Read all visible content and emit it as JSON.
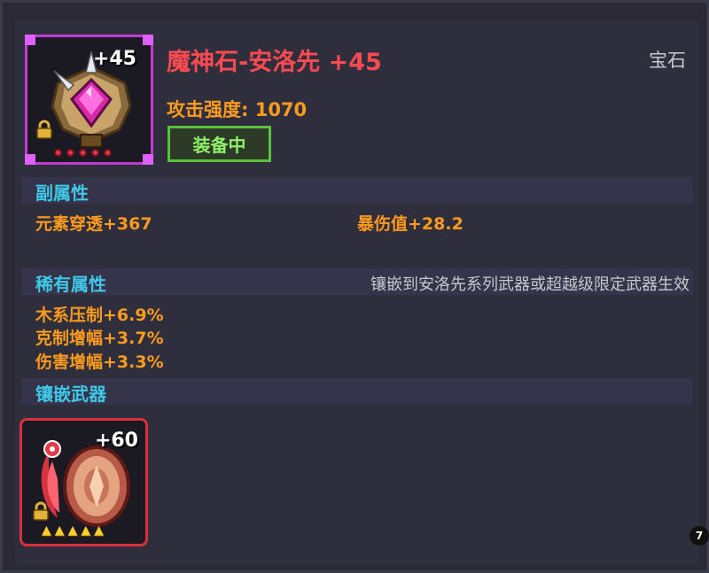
{
  "item": {
    "name": "魔神石-安洛先 +45",
    "category": "宝石",
    "attack": "攻击强度: 1070",
    "status_badge": "装备中",
    "icon": "demon-gem-icon",
    "icon_level": "+45",
    "refine_dots": 5
  },
  "sections": {
    "sub_attr_title": "副属性",
    "rare_attr_title": "稀有属性",
    "inlay_title": "镶嵌武器"
  },
  "sub_attrs": [
    "元素穿透+367",
    "暴伤值+28.2"
  ],
  "rare_attrs": {
    "note": "镶嵌到安洛先系列武器或超越级限定武器生效",
    "items": [
      "木系压制+6.9%",
      "克制增幅+3.7%",
      "伤害增幅+3.3%"
    ]
  },
  "weapon": {
    "icon": "flame-shield-weapon-icon",
    "level": "+60",
    "stars": 5
  },
  "page_badge": "7",
  "colors": {
    "title": "#ff4a52",
    "stat": "#ff9b1e",
    "section": "#3fc8e8",
    "equipped": "#59c33e",
    "gem_frame": "#c03bd3",
    "weapon_frame": "#d8303c"
  }
}
